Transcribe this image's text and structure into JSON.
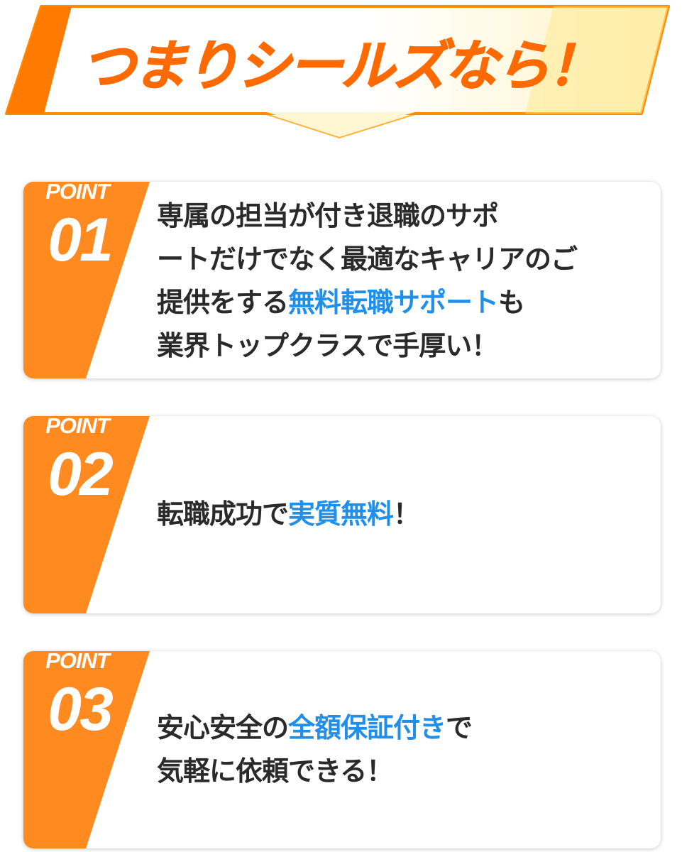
{
  "header": {
    "title": "つまりシールズなら！"
  },
  "colors": {
    "brand_orange": "#ff7a00",
    "badge_orange": "#ff8a1f",
    "highlight_blue": "#1f8fea",
    "text_dark": "#2a2a2a"
  },
  "points": [
    {
      "label": "POINT",
      "number": "01",
      "lines": [
        [
          {
            "t": "専属の担当が付き退職のサポ",
            "h": false
          }
        ],
        [
          {
            "t": "ートだけでなく最適なキャリアのご",
            "h": false
          }
        ],
        [
          {
            "t": "提供をする",
            "h": false
          },
          {
            "t": "無料転職サポート",
            "h": true
          },
          {
            "t": "も",
            "h": false
          }
        ],
        [
          {
            "t": "業界トップクラスで手厚い！",
            "h": false
          }
        ]
      ]
    },
    {
      "label": "POINT",
      "number": "02",
      "lines": [
        [
          {
            "t": "転職成功で",
            "h": false
          },
          {
            "t": "実質無料",
            "h": true
          },
          {
            "t": "！",
            "h": false
          }
        ]
      ]
    },
    {
      "label": "POINT",
      "number": "03",
      "lines": [
        [
          {
            "t": "安心安全の",
            "h": false
          },
          {
            "t": "全額保証付き",
            "h": true
          },
          {
            "t": "で",
            "h": false
          }
        ],
        [
          {
            "t": "気軽に依頼できる！",
            "h": false
          }
        ]
      ]
    }
  ]
}
